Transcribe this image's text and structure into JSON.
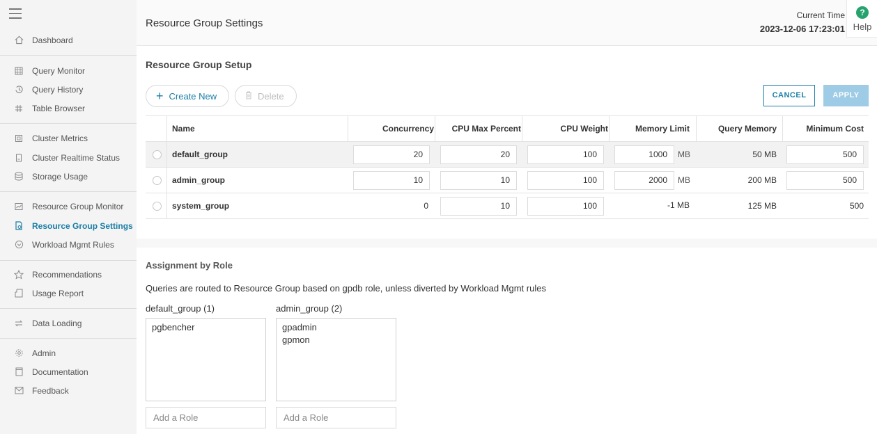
{
  "sidebar": {
    "items": [
      {
        "label": "Dashboard",
        "icon": "home-icon"
      },
      {
        "label": "Query Monitor",
        "icon": "grid-icon"
      },
      {
        "label": "Query History",
        "icon": "history-icon"
      },
      {
        "label": "Table Browser",
        "icon": "table-icon"
      },
      {
        "label": "Cluster Metrics",
        "icon": "metrics-icon"
      },
      {
        "label": "Cluster Realtime Status",
        "icon": "status-icon"
      },
      {
        "label": "Storage Usage",
        "icon": "database-icon"
      },
      {
        "label": "Resource Group Monitor",
        "icon": "chart-icon"
      },
      {
        "label": "Resource Group Settings",
        "icon": "settings-doc-icon",
        "active": true
      },
      {
        "label": "Workload Mgmt Rules",
        "icon": "shield-icon"
      },
      {
        "label": "Recommendations",
        "icon": "star-icon"
      },
      {
        "label": "Usage Report",
        "icon": "report-icon"
      },
      {
        "label": "Data Loading",
        "icon": "arrows-icon"
      },
      {
        "label": "Admin",
        "icon": "gear-icon"
      },
      {
        "label": "Documentation",
        "icon": "book-icon"
      },
      {
        "label": "Feedback",
        "icon": "mail-icon"
      }
    ]
  },
  "header": {
    "title": "Resource Group Settings",
    "time_label": "Current Time",
    "time_value": "2023-12-06 17:23:01",
    "help_label": "Help",
    "help_glyph": "?"
  },
  "setup": {
    "title": "Resource Group Setup",
    "create_label": "Create New",
    "delete_label": "Delete",
    "cancel_label": "CANCEL",
    "apply_label": "APPLY"
  },
  "table": {
    "columns": [
      "Name",
      "Concurrency",
      "CPU Max Percent",
      "CPU Weight",
      "Memory Limit",
      "Query Memory",
      "Minimum Cost"
    ],
    "unit": "MB",
    "rows": [
      {
        "name": "default_group",
        "concurrency": "20",
        "cpu_max": "20",
        "cpu_weight": "100",
        "mem_limit": "1000",
        "query_mem": "50 MB",
        "min_cost": "500"
      },
      {
        "name": "admin_group",
        "concurrency": "10",
        "cpu_max": "10",
        "cpu_weight": "100",
        "mem_limit": "2000",
        "query_mem": "200 MB",
        "min_cost": "500"
      },
      {
        "name": "system_group",
        "concurrency": "0",
        "cpu_max": "10",
        "cpu_weight": "100",
        "mem_limit": "-1 MB",
        "query_mem": "125 MB",
        "min_cost": "500"
      }
    ]
  },
  "assignment": {
    "title": "Assignment by Role",
    "description": "Queries are routed to Resource Group based on gpdb role, unless diverted by Workload Mgmt rules",
    "groups": [
      {
        "label": "default_group (1)",
        "roles": [
          "pgbencher"
        ],
        "placeholder": "Add a Role"
      },
      {
        "label": "admin_group (2)",
        "roles": [
          "gpadmin",
          "gpmon"
        ],
        "placeholder": "Add a Role"
      }
    ]
  },
  "colors": {
    "accent": "#1a7ea6",
    "help": "#26a36d",
    "apply_disabled": "#9ecbe6"
  }
}
